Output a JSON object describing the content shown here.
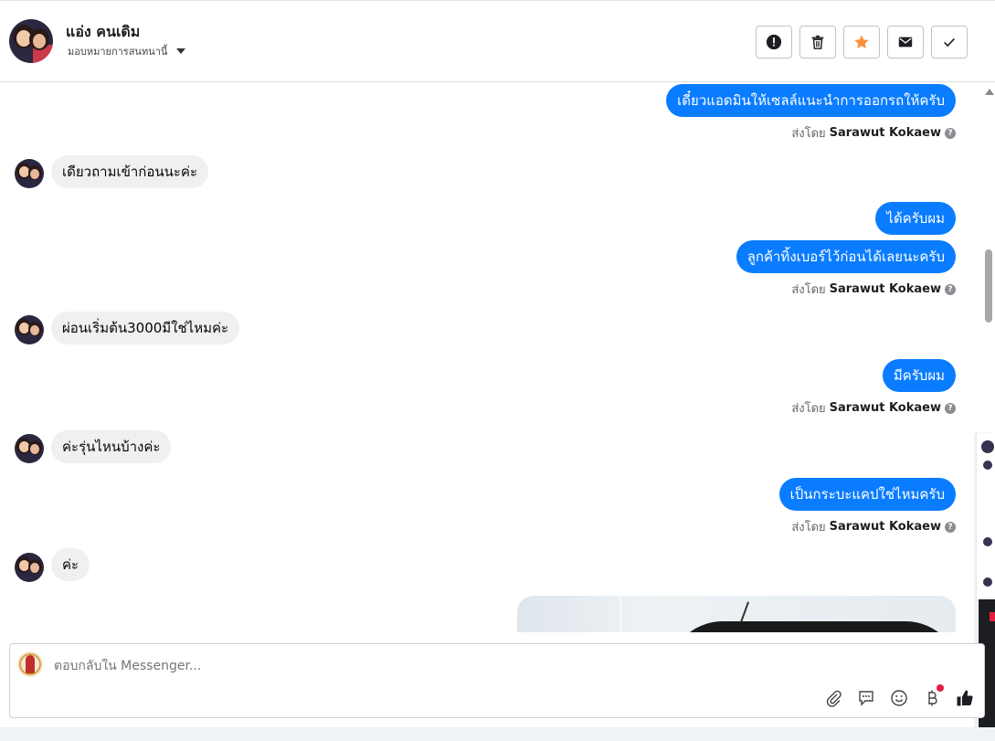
{
  "header": {
    "contact_name": "แอ่ง คนเดิม",
    "assigned_label": "มอบหมายการสนทนานี้"
  },
  "messages": [
    {
      "side": "out",
      "text": "เดี๋ยวแอดมินให้เซลล์แนะนำการออกรถให้ครับ"
    },
    {
      "side": "in",
      "text": "เดียวถามเข้าก่อนนะค่ะ"
    },
    {
      "side": "out",
      "text": "ได้ครับผม"
    },
    {
      "side": "out",
      "text": "ลูกค้าทิ้งเบอร์ไว้ก่อนได้เลยนะครับ"
    },
    {
      "side": "in",
      "text": "ผ่อนเริ่มต้น3000มีใช่ไหมค่ะ"
    },
    {
      "side": "out",
      "text": "มีครับผม"
    },
    {
      "side": "in",
      "text": "ค่ะรุ่นไหนบ้างค่ะ"
    },
    {
      "side": "out",
      "text": "เป็นกระบะแคปใช่ไหมครับ"
    },
    {
      "side": "in",
      "text": "ค่ะ"
    }
  ],
  "sent_by": {
    "prefix": "ส่งโดย",
    "name": "Sarawut Kokaew",
    "help": "?"
  },
  "composer": {
    "placeholder": "ตอบกลับใน Messenger..."
  },
  "colors": {
    "outgoing_bubble": "#0a7cff",
    "incoming_bubble": "#f0f0f0",
    "star": "#f7923b",
    "notification_dot": "#e41e3f"
  },
  "icons": {
    "actions": [
      "alert-icon",
      "trash-icon",
      "star-icon",
      "mail-icon",
      "check-icon"
    ],
    "composer_tools": [
      "paperclip-icon",
      "saved-reply-icon",
      "emoji-icon",
      "baht-icon",
      "thumbs-up-icon"
    ]
  }
}
